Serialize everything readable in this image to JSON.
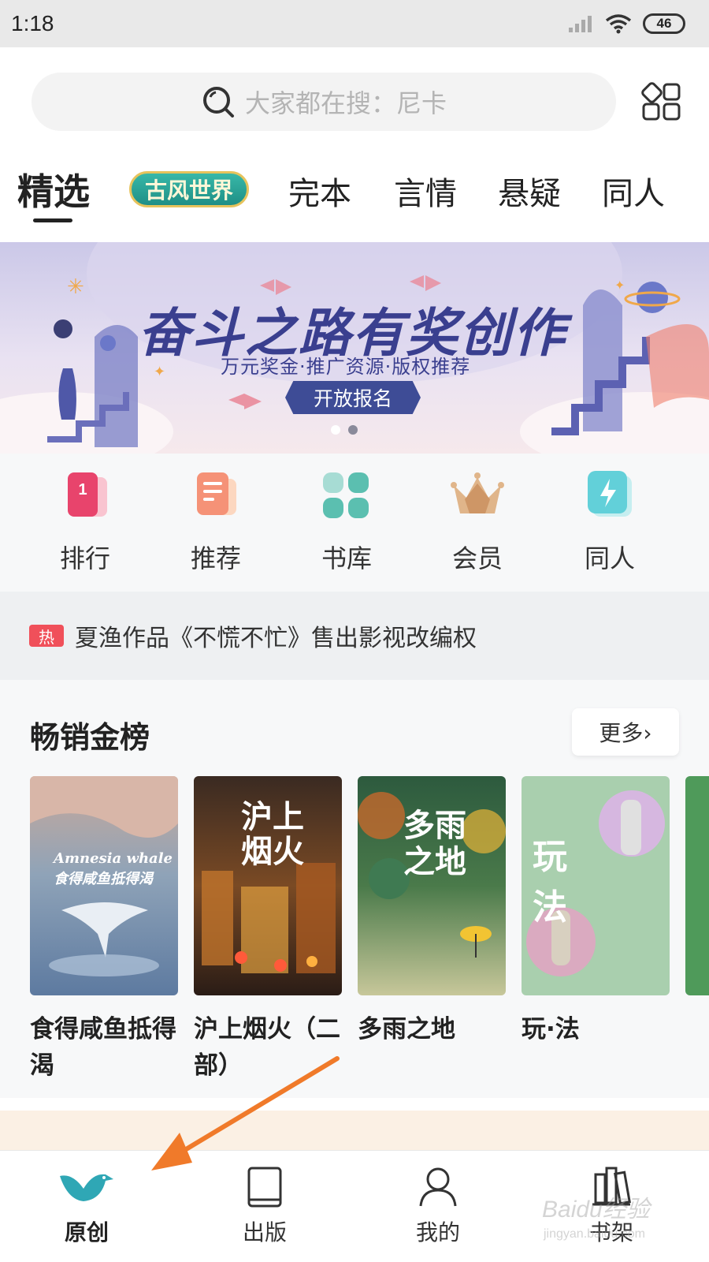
{
  "status_bar": {
    "time": "1:18",
    "battery": "46"
  },
  "search": {
    "placeholder": "大家都在搜：尼卡"
  },
  "tabs": [
    {
      "label": "精选",
      "active": true
    },
    {
      "label": "古风世界",
      "special": true
    },
    {
      "label": "完本"
    },
    {
      "label": "言情"
    },
    {
      "label": "悬疑"
    },
    {
      "label": "同人"
    }
  ],
  "banner": {
    "title": "奋斗之路有奖创作",
    "subtitle": "万元奖金·推广资源·版权推荐",
    "button": "开放报名",
    "dots": 2,
    "active_dot": 0
  },
  "shortcuts": [
    {
      "label": "排行",
      "icon": "ranking-icon"
    },
    {
      "label": "推荐",
      "icon": "recommend-icon"
    },
    {
      "label": "书库",
      "icon": "library-icon"
    },
    {
      "label": "会员",
      "icon": "crown-icon"
    },
    {
      "label": "同人",
      "icon": "lightning-icon"
    }
  ],
  "hot_news": {
    "badge": "热",
    "text": "夏渔作品《不慌不忙》售出影视改编权"
  },
  "bestseller": {
    "title": "畅销金榜",
    "more": "更多›",
    "books": [
      {
        "name": "食得咸鱼抵得渴",
        "cover_text": "Amnesia whale\n食得咸鱼抵得渴"
      },
      {
        "name": "沪上烟火（二部）",
        "cover_text": "沪上烟火"
      },
      {
        "name": "多雨之地",
        "cover_text": "多雨之地"
      },
      {
        "name": "玩·法",
        "cover_text": "玩法"
      }
    ]
  },
  "bottom_nav": [
    {
      "label": "原创",
      "icon": "bird-icon",
      "active": true
    },
    {
      "label": "出版",
      "icon": "book-icon"
    },
    {
      "label": "我的",
      "icon": "user-icon"
    },
    {
      "label": "书架",
      "icon": "bookshelf-icon"
    }
  ],
  "watermark": {
    "brand": "Baidu经验",
    "url": "jingyan.baidu.com"
  },
  "colors": {
    "accent": "#2fa7b5",
    "hot": "#f0505a",
    "banner_blue": "#3a3f8f",
    "arrow": "#f07a2a"
  }
}
